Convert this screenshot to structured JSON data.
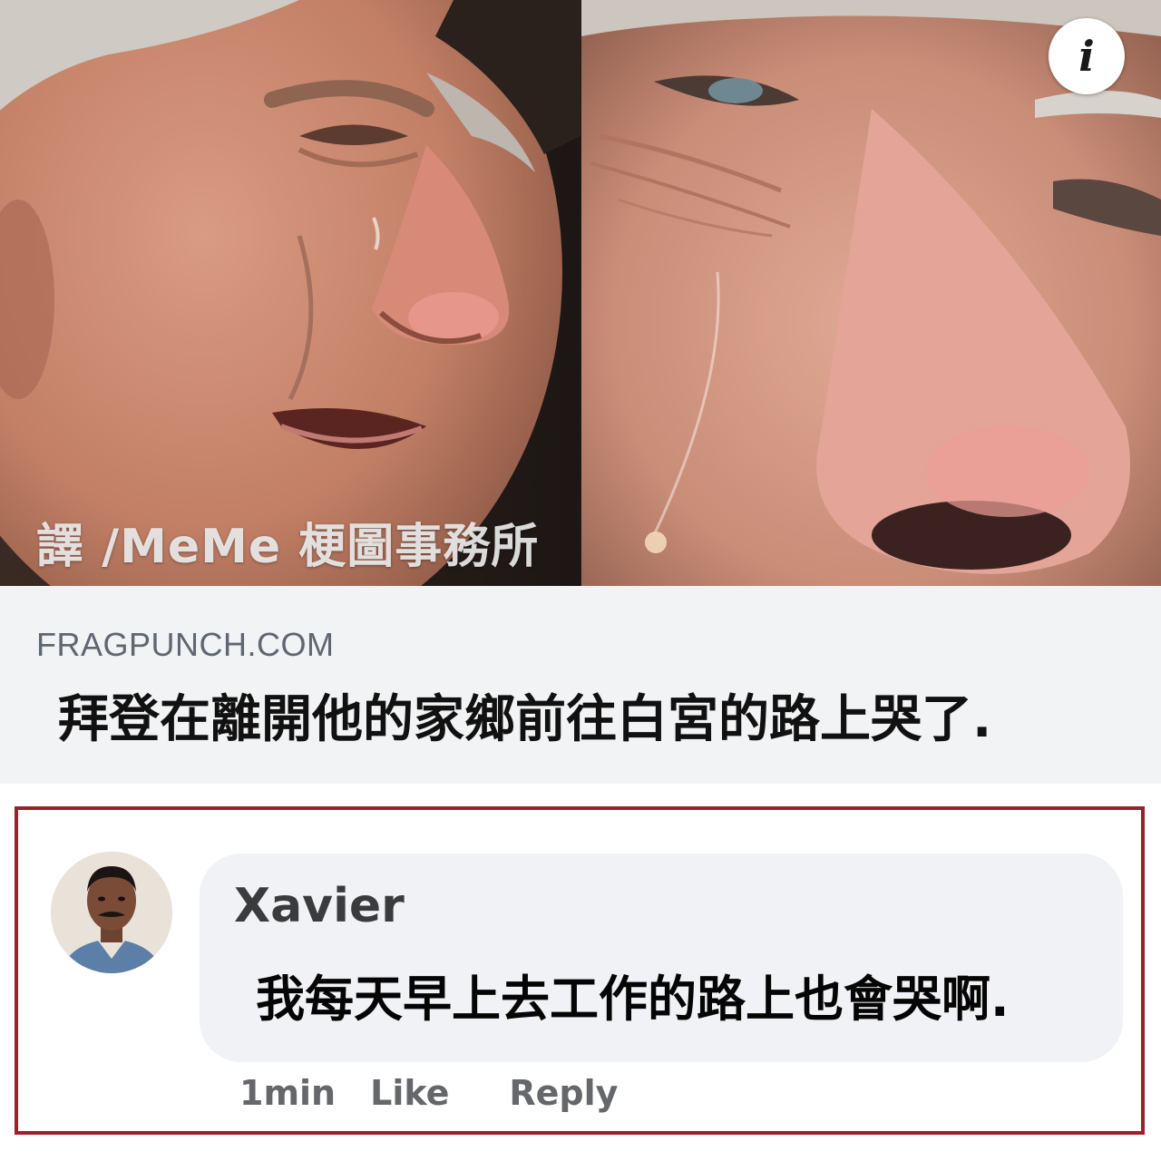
{
  "post": {
    "watermark": "譯 /MeMe 梗圖事務所",
    "info_glyph": "i"
  },
  "link_preview": {
    "domain": "FRAGPUNCH.COM",
    "title": "拜登在離開他的家鄉前往白宮的路上哭了."
  },
  "comment": {
    "author": "Xavier",
    "text": "我每天早上去工作的路上也會哭啊.",
    "time": "1min",
    "like_label": "Like",
    "reply_label": "Reply"
  },
  "colors": {
    "highlight_border": "#9c1f2a",
    "bubble_bg": "#f0f2f5",
    "preview_bg": "#f2f3f5",
    "meta_text": "#65676b"
  },
  "icons": {
    "info": "info-icon"
  }
}
